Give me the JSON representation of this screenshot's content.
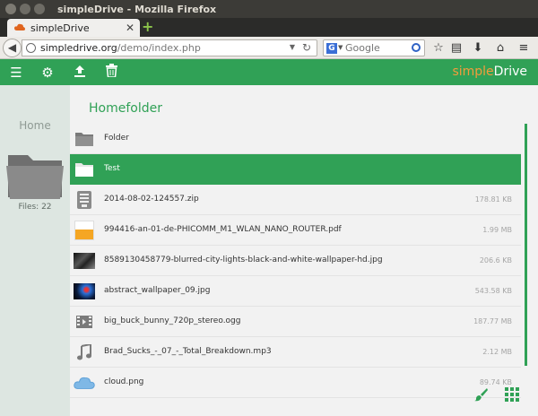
{
  "window": {
    "title": "simpleDrive - Mozilla Firefox"
  },
  "tab": {
    "label": "simpleDrive",
    "close": "✕",
    "new": "+"
  },
  "nav": {
    "url_host": "simpledrive.org",
    "url_path": "/demo/index.php",
    "search_engine": "G",
    "search_placeholder": "Google"
  },
  "toolbar": {
    "brand_prefix": "simple",
    "brand_suffix": "Drive",
    "accent": "#30a156",
    "brand_accent": "#f39c3c"
  },
  "sidebar": {
    "label": "Home",
    "files_count": "Files: 22"
  },
  "main": {
    "heading": "Homefolder",
    "files": [
      {
        "name": "Folder",
        "size": "",
        "icon": "folder-icon",
        "selected": false
      },
      {
        "name": "Test",
        "size": "",
        "icon": "folder-icon",
        "selected": true
      },
      {
        "name": "2014-08-02-124557.zip",
        "size": "178.81 KB",
        "icon": "archive-icon",
        "selected": false
      },
      {
        "name": "994416-an-01-de-PHICOMM_M1_WLAN_NANO_ROUTER.pdf",
        "size": "1.99 MB",
        "icon": "pdf-thumbnail",
        "selected": false
      },
      {
        "name": "8589130458779-blurred-city-lights-black-and-white-wallpaper-hd.jpg",
        "size": "206.6 KB",
        "icon": "image-thumbnail",
        "selected": false
      },
      {
        "name": "abstract_wallpaper_09.jpg",
        "size": "543.58 KB",
        "icon": "image-thumbnail",
        "selected": false
      },
      {
        "name": "big_buck_bunny_720p_stereo.ogg",
        "size": "187.77 MB",
        "icon": "video-icon",
        "selected": false
      },
      {
        "name": "Brad_Sucks_-_07_-_Total_Breakdown.mp3",
        "size": "2.12 MB",
        "icon": "music-icon",
        "selected": false
      },
      {
        "name": "cloud.png",
        "size": "89.74 KB",
        "icon": "image-thumbnail",
        "selected": false
      }
    ]
  }
}
